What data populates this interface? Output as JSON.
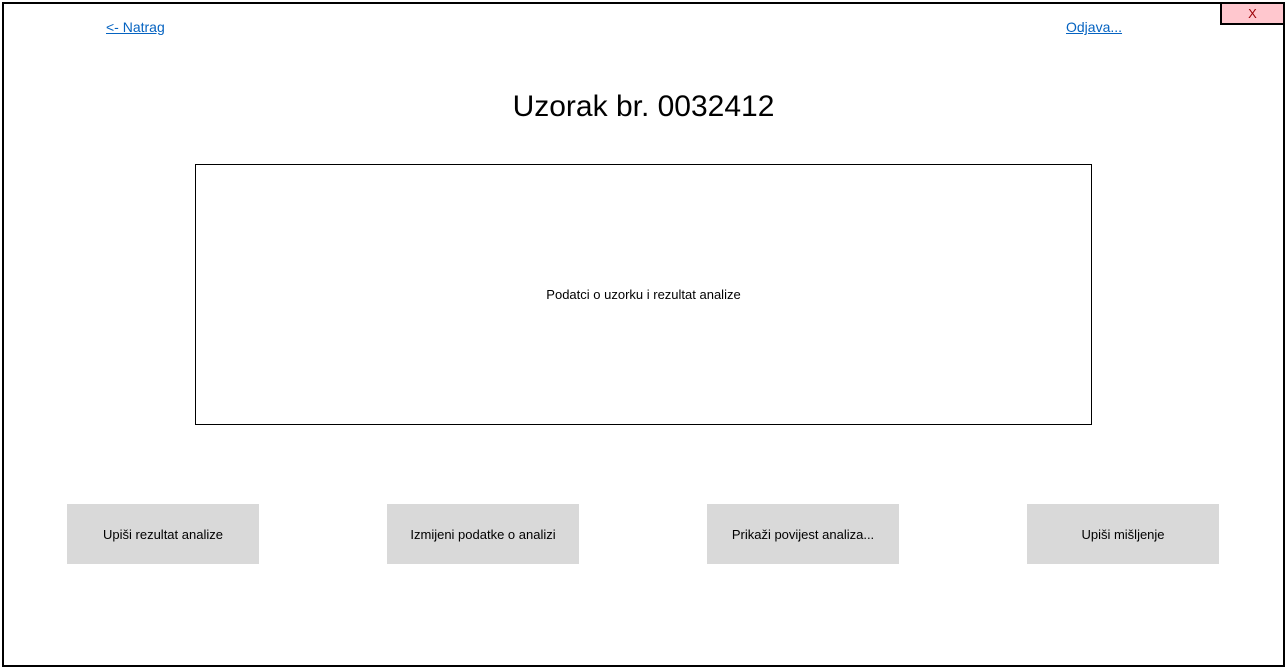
{
  "nav": {
    "back_label": "<- Natrag",
    "logout_label": "Odjava..."
  },
  "window": {
    "close_label": "X"
  },
  "page": {
    "title": "Uzorak br. 0032412"
  },
  "data_box": {
    "label": "Podatci o uzorku i rezultat analize"
  },
  "actions": [
    {
      "label": "Upiši rezultat analize"
    },
    {
      "label": "Izmijeni podatke o analizi"
    },
    {
      "label": "Prikaži povijest analiza..."
    },
    {
      "label": "Upiši mišljenje"
    }
  ],
  "colors": {
    "link": "#0563c1",
    "button_bg": "#d9d9d9",
    "close_bg": "#ffc7ce"
  }
}
